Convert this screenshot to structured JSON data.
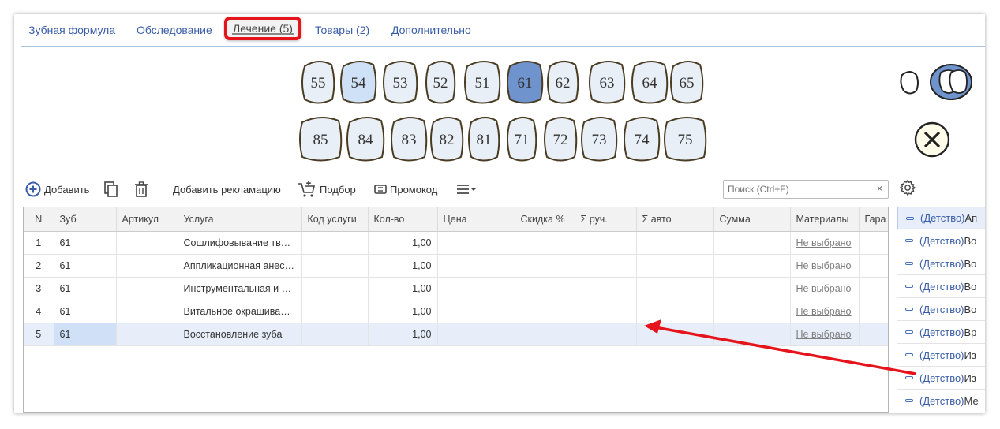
{
  "tabs": [
    {
      "label": "Зубная формула",
      "active": false
    },
    {
      "label": "Обследование",
      "active": false
    },
    {
      "label": "Лечение (5)",
      "active": true
    },
    {
      "label": "Товары (2)",
      "active": false
    },
    {
      "label": "Дополнительно",
      "active": false
    }
  ],
  "teeth": {
    "upper": [
      "55",
      "54",
      "53",
      "52",
      "51",
      "61",
      "62",
      "63",
      "64",
      "65"
    ],
    "lower": [
      "85",
      "84",
      "83",
      "82",
      "81",
      "71",
      "72",
      "73",
      "74",
      "75"
    ],
    "selected": "61",
    "highlighted": "54",
    "colors": {
      "fill": "#e9eff6",
      "selected": "#6f93cd",
      "highlighted": "#cfe1f7",
      "outline": "#4a3c22"
    }
  },
  "toolbar": {
    "add_label": "Добавить",
    "complaint_label": "Добавить рекламацию",
    "selection_label": "Подбор",
    "promo_label": "Промокод",
    "search_placeholder": "Поиск (Ctrl+F)",
    "clear_label": "×"
  },
  "table": {
    "columns": [
      "N",
      "Зуб",
      "Артикул",
      "Услуга",
      "Код услуги",
      "Кол-во",
      "Цена",
      "Скидка %",
      "Σ руч.",
      "Σ авто",
      "Сумма",
      "Материалы",
      "Гара"
    ],
    "rows": [
      {
        "n": "1",
        "tooth": "61",
        "article": "",
        "service": "Сошлифовывание твердых тканей",
        "code": "",
        "qty": "1,00",
        "price": "",
        "discount": "",
        "sum_manual": "",
        "sum_auto": "",
        "total": "",
        "materials": "Не выбрано"
      },
      {
        "n": "2",
        "tooth": "61",
        "article": "",
        "service": "Аппликационная анестезия",
        "code": "",
        "qty": "1,00",
        "price": "",
        "discount": "",
        "sum_manual": "",
        "sum_auto": "",
        "total": "",
        "materials": "Не выбрано"
      },
      {
        "n": "3",
        "tooth": "61",
        "article": "",
        "service": "Инструментальная и медикаментозная обработка",
        "code": "",
        "qty": "1,00",
        "price": "",
        "discount": "",
        "sum_manual": "",
        "sum_auto": "",
        "total": "",
        "materials": "Не выбрано"
      },
      {
        "n": "4",
        "tooth": "61",
        "article": "",
        "service": "Витальное окрашивание",
        "code": "",
        "qty": "1,00",
        "price": "",
        "discount": "",
        "sum_manual": "",
        "sum_auto": "",
        "total": "",
        "materials": "Не выбрано"
      },
      {
        "n": "5",
        "tooth": "61",
        "article": "",
        "service": "Восстановление зуба",
        "code": "",
        "qty": "1,00",
        "price": "",
        "discount": "",
        "sum_manual": "",
        "sum_auto": "",
        "total": "",
        "materials": "Не выбрано"
      }
    ],
    "selected_row": 4
  },
  "right_panel": {
    "items": [
      {
        "group": "(Детство)",
        "text": "Ап"
      },
      {
        "group": "(Детство)",
        "text": "Во"
      },
      {
        "group": "(Детство)",
        "text": "Во"
      },
      {
        "group": "(Детство)",
        "text": "Во"
      },
      {
        "group": "(Детство)",
        "text": "Во"
      },
      {
        "group": "(Детство)",
        "text": "Вр"
      },
      {
        "group": "(Детство)",
        "text": "Из"
      },
      {
        "group": "(Детство)",
        "text": "Из"
      },
      {
        "group": "(Детство)",
        "text": "Ме"
      }
    ]
  },
  "colors": {
    "accent": "#3a5da8",
    "highlight_red": "#e5141a",
    "selected_row": "#e7eefa"
  }
}
